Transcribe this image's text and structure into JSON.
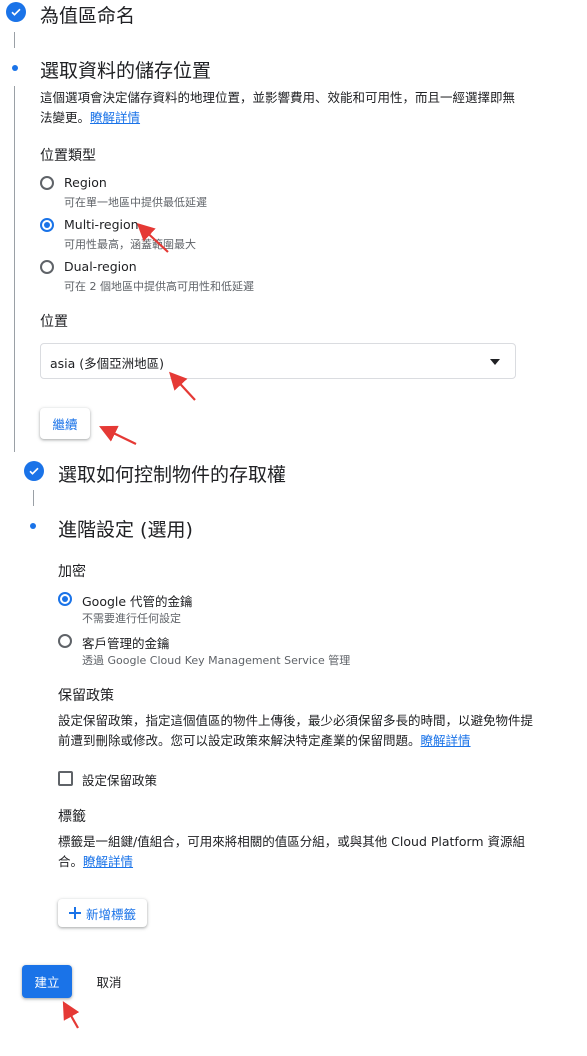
{
  "colors": {
    "accent": "#1a73e8",
    "annotation_arrow": "#e53935"
  },
  "steps": {
    "name_bucket": {
      "title": "為值區命名"
    },
    "storage_location": {
      "title": "選取資料的儲存位置",
      "description": "這個選項會決定儲存資料的地理位置，並影響費用、效能和可用性，而且一經選擇即無法變更。",
      "learn_more": "瞭解詳情",
      "location_type_label": "位置類型",
      "options": [
        {
          "label": "Region",
          "desc": "可在單一地區中提供最低延遲",
          "selected": false
        },
        {
          "label": "Multi-region",
          "desc": "可用性最高，涵蓋範圍最大",
          "selected": true
        },
        {
          "label": "Dual-region",
          "desc": "可在 2 個地區中提供高可用性和低延遲",
          "selected": false
        }
      ],
      "location_label": "位置",
      "location_value": "asia (多個亞洲地區)",
      "continue_label": "繼續"
    },
    "access_control": {
      "title": "選取如何控制物件的存取權"
    },
    "advanced": {
      "title": "進階設定 (選用)",
      "encryption_label": "加密",
      "encryption_options": [
        {
          "label": "Google 代管的金鑰",
          "desc": "不需要進行任何設定",
          "selected": true
        },
        {
          "label": "客戶管理的金鑰",
          "desc": "透過 Google Cloud Key Management Service 管理",
          "selected": false
        }
      ],
      "retention_label": "保留政策",
      "retention_desc": "設定保留政策，指定這個值區的物件上傳後，最少必須保留多長的時間，以避免物件提前遭到刪除或修改。您可以設定政策來解決特定產業的保留問題。",
      "retention_learn_more": "瞭解詳情",
      "retention_checkbox_label": "設定保留政策",
      "retention_checkbox_checked": false,
      "labels_label": "標籤",
      "labels_desc": "標籤是一組鍵/值組合，可用來將相關的值區分組，或與其他 Cloud Platform 資源組合。",
      "labels_learn_more": "瞭解詳情",
      "add_label_button": "新增標籤"
    }
  },
  "footer": {
    "create_label": "建立",
    "cancel_label": "取消"
  }
}
